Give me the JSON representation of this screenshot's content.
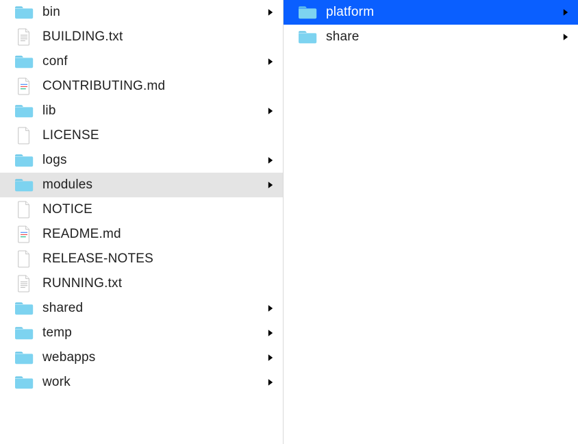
{
  "left": {
    "items": [
      {
        "name": "bin",
        "type": "folder",
        "expandable": true
      },
      {
        "name": "BUILDING.txt",
        "type": "txt",
        "expandable": false
      },
      {
        "name": "conf",
        "type": "folder",
        "expandable": true
      },
      {
        "name": "CONTRIBUTING.md",
        "type": "md",
        "expandable": false
      },
      {
        "name": "lib",
        "type": "folder",
        "expandable": true
      },
      {
        "name": "LICENSE",
        "type": "blank",
        "expandable": false
      },
      {
        "name": "logs",
        "type": "folder",
        "expandable": true
      },
      {
        "name": "modules",
        "type": "folder",
        "expandable": true,
        "state": "active"
      },
      {
        "name": "NOTICE",
        "type": "blank",
        "expandable": false
      },
      {
        "name": "README.md",
        "type": "md",
        "expandable": false
      },
      {
        "name": "RELEASE-NOTES",
        "type": "blank",
        "expandable": false
      },
      {
        "name": "RUNNING.txt",
        "type": "txt",
        "expandable": false
      },
      {
        "name": "shared",
        "type": "folder",
        "expandable": true
      },
      {
        "name": "temp",
        "type": "folder",
        "expandable": true
      },
      {
        "name": "webapps",
        "type": "folder",
        "expandable": true
      },
      {
        "name": "work",
        "type": "folder",
        "expandable": true
      }
    ]
  },
  "right": {
    "items": [
      {
        "name": "platform",
        "type": "folder",
        "expandable": true,
        "state": "selected"
      },
      {
        "name": "share",
        "type": "folder",
        "expandable": true
      }
    ]
  }
}
